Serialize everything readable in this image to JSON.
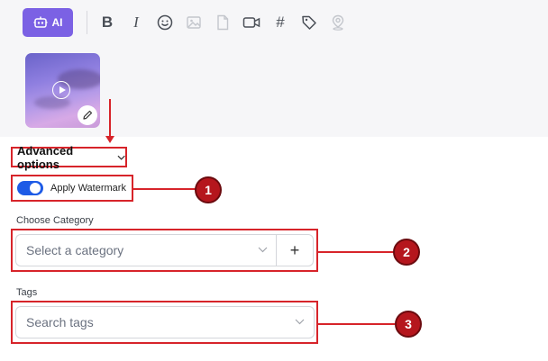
{
  "toolbar": {
    "ai_label": "AI",
    "bold_glyph": "B",
    "italic_glyph": "I",
    "hashtag_glyph": "#",
    "icons": [
      "ai-robot-icon",
      "bold-icon",
      "italic-icon",
      "emoji-icon",
      "image-icon",
      "file-icon",
      "video-icon",
      "hashtag-icon",
      "tag-icon",
      "location-icon"
    ],
    "accent_color": "#7b61e4"
  },
  "media": {
    "type": "video",
    "icons": [
      "play-icon",
      "edit-pencil-icon"
    ]
  },
  "advanced": {
    "label": "Advanced options"
  },
  "watermark": {
    "label": "Apply Watermark",
    "enabled": true,
    "toggle_color": "#1e5be6"
  },
  "category": {
    "label": "Choose Category",
    "placeholder": "Select a category",
    "add_label": "+"
  },
  "tags": {
    "label": "Tags",
    "placeholder": "Search tags"
  },
  "annotations": {
    "color": "#d7242a",
    "badges": [
      "1",
      "2",
      "3"
    ]
  }
}
